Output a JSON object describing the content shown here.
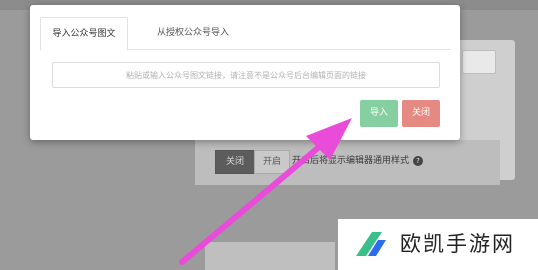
{
  "modal": {
    "tabs": [
      {
        "label": "导入公众号图文"
      },
      {
        "label": "从授权公众号导入"
      }
    ],
    "url_input": {
      "placeholder": "粘贴或输入公众号图文链接，请注意不是公众号后台编辑页面的链接",
      "value": ""
    },
    "import_label": "导入",
    "close_label": "关闭"
  },
  "background": {
    "segment_a": "关闭",
    "segment_b": "开启",
    "hint_prefix": "开",
    "hint_text": "启后将显示编辑器通用样式",
    "help_glyph": "?"
  },
  "watermark": {
    "text": "欧凯手游网"
  },
  "colors": {
    "import": "#86cfa1",
    "close": "#e58a82",
    "arrow": "#e84cd9",
    "logo_green": "#3bbf8a",
    "logo_blue": "#2c6df0"
  }
}
